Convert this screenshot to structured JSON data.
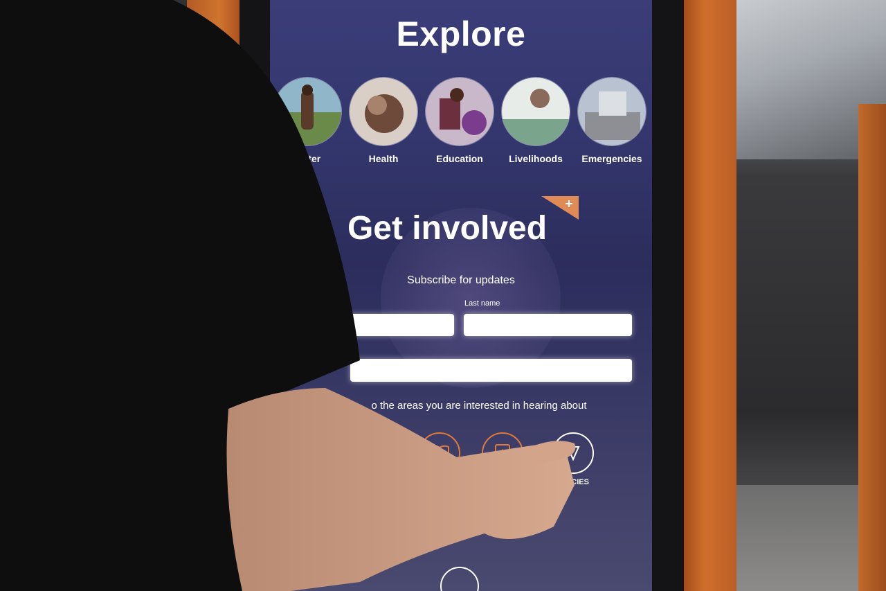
{
  "explore": {
    "title": "Explore",
    "categories": [
      {
        "label": "Water"
      },
      {
        "label": "Health"
      },
      {
        "label": "Education"
      },
      {
        "label": "Livelihoods"
      },
      {
        "label": "Emergencies"
      }
    ]
  },
  "get_involved": {
    "title": "Get involved",
    "subscribe_text": "Subscribe for updates",
    "last_name_label": "Last name",
    "interest_text": "o the areas you are interested in hearing about",
    "topics": [
      {
        "icon": "health-icon"
      },
      {
        "icon": "education-book-icon"
      },
      {
        "icon": "livelihoods-icon"
      },
      {
        "icon": "emergencies-icon"
      }
    ],
    "emergencies_partial_label": "ENCIES"
  },
  "colors": {
    "accent_orange": "#e07a3a",
    "screen_blue": "#33366c"
  }
}
